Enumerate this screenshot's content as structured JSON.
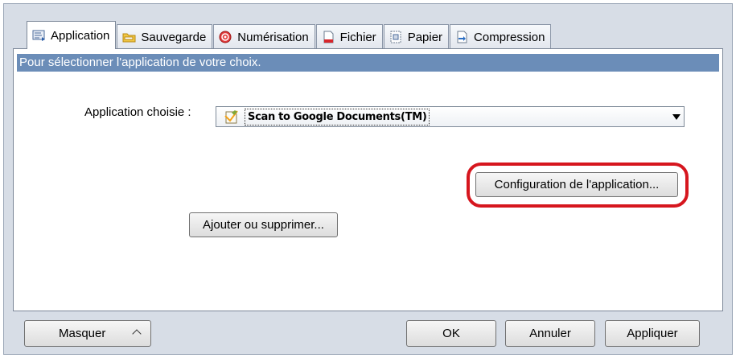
{
  "tabs": [
    {
      "label": "Application",
      "icon": "application-icon",
      "active": true
    },
    {
      "label": "Sauvegarde",
      "icon": "folder-icon",
      "active": false
    },
    {
      "label": "Numérisation",
      "icon": "scan-icon",
      "active": false
    },
    {
      "label": "Fichier",
      "icon": "file-icon",
      "active": false
    },
    {
      "label": "Papier",
      "icon": "paper-icon",
      "active": false
    },
    {
      "label": "Compression",
      "icon": "compression-icon",
      "active": false
    }
  ],
  "panel": {
    "description": "Pour sélectionner l'application de votre choix.",
    "app_label": "Application choisie :",
    "selected_app": "Scan to Google Documents(TM)",
    "selected_app_icon": "google-docs-icon",
    "config_button": "Configuration de l'application...",
    "add_remove_button": "Ajouter ou supprimer..."
  },
  "footer": {
    "hide_button": "Masquer",
    "ok_button": "OK",
    "cancel_button": "Annuler",
    "apply_button": "Appliquer"
  },
  "colors": {
    "description_bar": "#6b8db8",
    "highlight": "#d6161e",
    "frame": "#d7dde6"
  }
}
